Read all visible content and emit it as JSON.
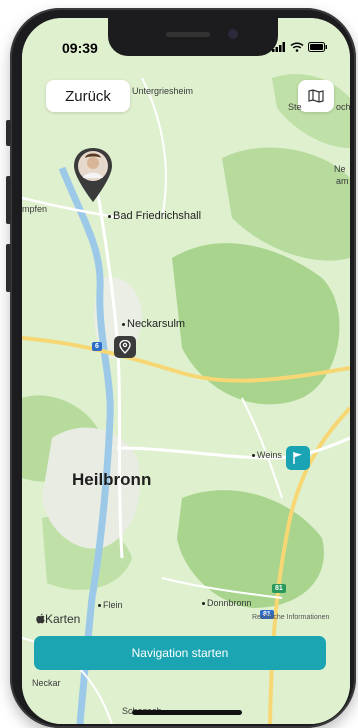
{
  "status_bar": {
    "time": "09:39"
  },
  "header": {
    "back_label": "Zurück"
  },
  "map": {
    "places": {
      "untergriesheim": "Untergriesheim",
      "ste": "Ste",
      "och": "och",
      "ne": "Ne",
      "am": "am",
      "mpfen": "mpfen",
      "bad_friedrichshall": "Bad Friedrichshall",
      "neckarsulm": "Neckarsulm",
      "heilbronn": "Heilbronn",
      "weins": "Weins",
      "flein": "Flein",
      "donnbronn": "Donnbronn",
      "neckar": "Neckar",
      "schozach": "Schozach"
    },
    "road_badges": {
      "b6": "6",
      "a81": "81",
      "a81_lower": "81"
    },
    "attribution": "Karten",
    "legal": "Rechtliche Informationen"
  },
  "footer": {
    "navigation_label": "Navigation starten"
  },
  "colors": {
    "accent": "#1ba4b2",
    "map_base": "#dff0cf"
  }
}
